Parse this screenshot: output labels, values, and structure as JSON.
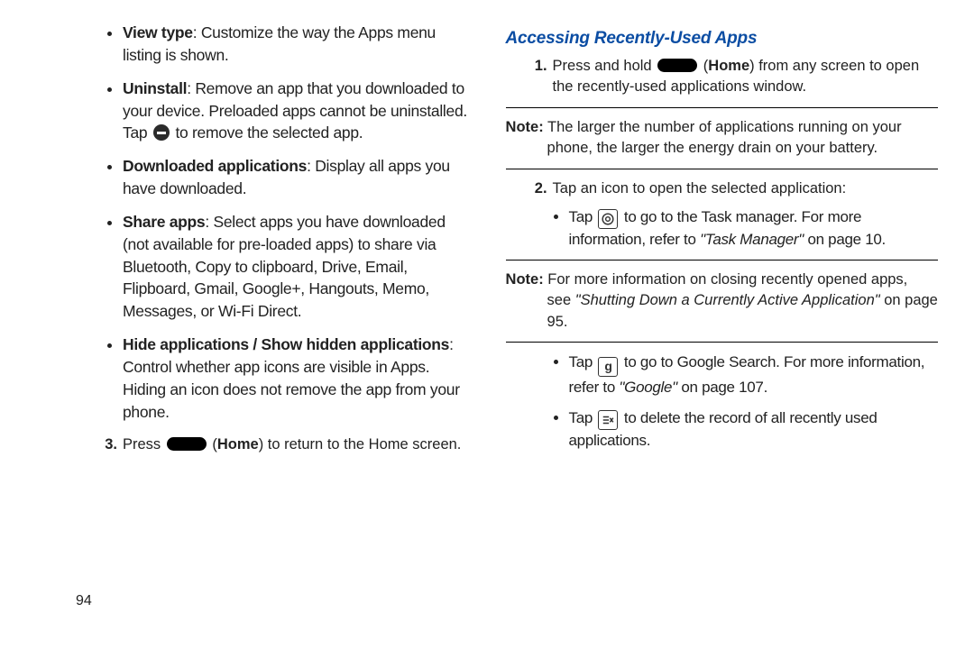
{
  "page_number": "94",
  "left": {
    "bullets": [
      {
        "label": "View type",
        "text": ": Customize the way the Apps menu listing is shown."
      },
      {
        "label": "Uninstall",
        "text_before": ": Remove an app that you downloaded to your device. Preloaded apps cannot be uninstalled. Tap ",
        "text_after": " to remove the selected app.",
        "has_minus_icon": true
      },
      {
        "label": "Downloaded applications",
        "text": ": Display all apps you have downloaded."
      },
      {
        "label": "Share apps",
        "text": ": Select apps you have downloaded (not available for pre-loaded apps) to share via Bluetooth, Copy to clipboard, Drive, Email, Flipboard, Gmail, Google+, Hangouts, Memo, Messages, or Wi-Fi Direct."
      },
      {
        "label": "Hide applications / Show hidden applications",
        "text": ": Control whether app icons are visible in Apps. Hiding an icon does not remove the app from your phone."
      }
    ],
    "step3_num": "3",
    "step3_before": "Press ",
    "step3_mid": " (",
    "step3_home": "Home",
    "step3_after": ") to return to the Home screen."
  },
  "right": {
    "heading": "Accessing Recently-Used Apps",
    "step1_num": "1",
    "step1_before": "Press and hold ",
    "step1_mid": " (",
    "step1_home": "Home",
    "step1_after": ") from any screen to open the recently-used applications window.",
    "note1_label": "Note:",
    "note1_text": " The larger the number of applications running on your",
    "note1_text2": "phone, the larger the energy drain on your battery.",
    "step2_num": "2",
    "step2_text": "Tap an icon to open the selected application:",
    "sub1_before": "Tap ",
    "sub1_after": " to go to the Task manager. For more information, refer to ",
    "sub1_ref": "\"Task Manager\"",
    "sub1_tail": " on page 10.",
    "note2_label": "Note:",
    "note2_text": " For more information on closing recently opened apps,",
    "note2_text2a": "see ",
    "note2_ref": "\"Shutting Down a Currently Active Application\"",
    "note2_text2b": " on page 95.",
    "sub2_before": "Tap ",
    "sub2_after": " to go to Google Search. For more information, refer to ",
    "sub2_ref": "\"Google\"",
    "sub2_tail": " on page 107.",
    "sub3_before": "Tap ",
    "sub3_after": " to delete the record of all recently used applications."
  }
}
